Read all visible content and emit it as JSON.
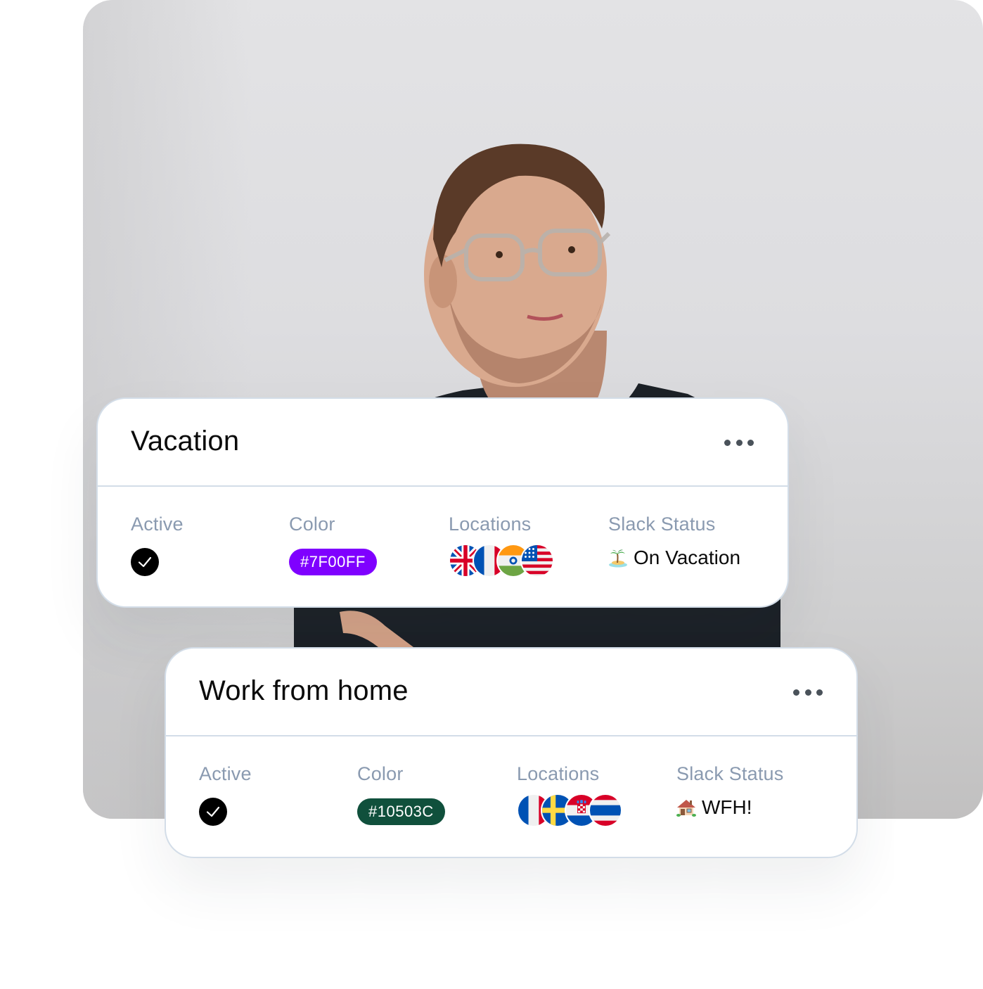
{
  "cards": [
    {
      "title": "Vacation",
      "more_label": "More options",
      "fields": {
        "active_label": "Active",
        "color_label": "Color",
        "locations_label": "Locations",
        "slack_label": "Slack Status"
      },
      "active": true,
      "color": {
        "hex_label": "#7F00FF",
        "value": "#7F00FF"
      },
      "locations": [
        "United Kingdom",
        "France",
        "India",
        "United States"
      ],
      "slack_status": {
        "emoji": "desert-island-icon",
        "text": "On Vacation"
      }
    },
    {
      "title": "Work from home",
      "more_label": "More options",
      "fields": {
        "active_label": "Active",
        "color_label": "Color",
        "locations_label": "Locations",
        "slack_label": "Slack Status"
      },
      "active": true,
      "color": {
        "hex_label": "#10503C",
        "value": "#10503C"
      },
      "locations": [
        "France",
        "Sweden",
        "Croatia",
        "Thailand"
      ],
      "slack_status": {
        "emoji": "house-icon",
        "text": "WFH!"
      }
    }
  ],
  "theme": {
    "label_color": "#8A9AB0",
    "border_color": "#D3DDE8",
    "check_color": "#000000"
  }
}
